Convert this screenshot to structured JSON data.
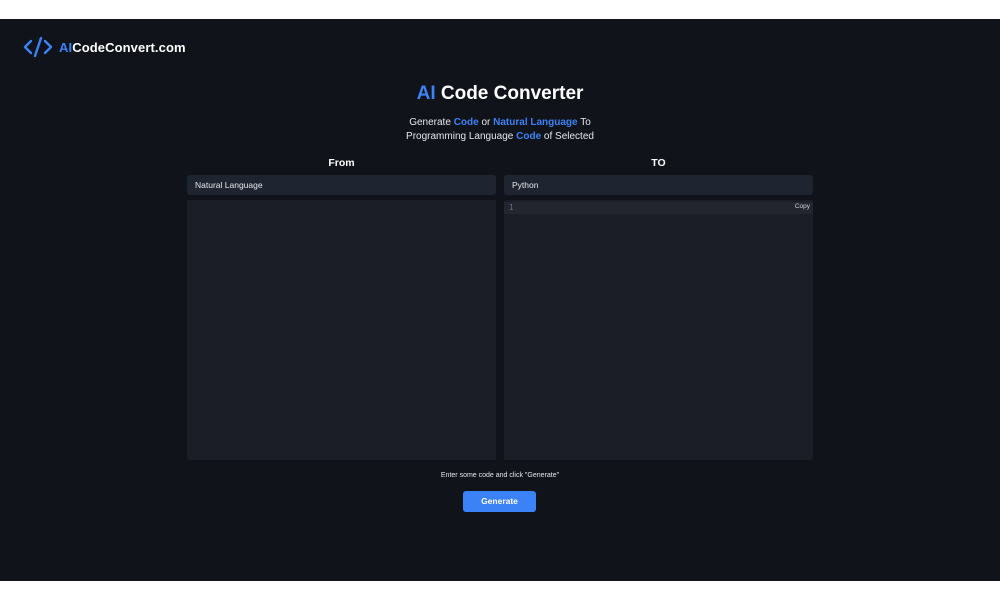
{
  "header": {
    "logo_accent": "AI",
    "logo_rest": "CodeConvert.com"
  },
  "hero": {
    "title_accent": "AI",
    "title_rest": " Code Converter",
    "subtitle_parts": [
      "Generate ",
      "Code",
      " or ",
      "Natural Language",
      " To",
      "Programming Language ",
      "Code",
      " of Selected"
    ]
  },
  "from": {
    "heading": "From",
    "selected": "Natural Language",
    "input_value": ""
  },
  "to": {
    "heading": "TO",
    "selected": "Python",
    "line_number": "1",
    "copy_label": "Copy"
  },
  "footer": {
    "hint": "Enter some code and click \"Generate\"",
    "generate_label": "Generate"
  },
  "colors": {
    "background": "#10131a",
    "panel": "#1c1e27",
    "select": "#1f2431",
    "accent": "#3b82f6"
  }
}
